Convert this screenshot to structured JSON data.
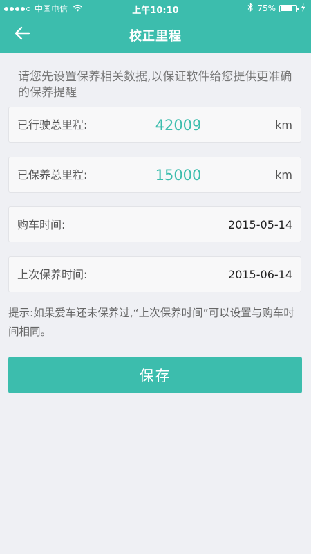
{
  "status_bar": {
    "carrier": "中国电信",
    "time": "上午10:10",
    "battery_text": "75%",
    "battery_level": 0.75
  },
  "nav": {
    "title": "校正里程",
    "back_icon": "arrow-left-icon"
  },
  "intro": "请您先设置保养相关数据,以保证软件给您提供更准确的保养提醒",
  "fields": {
    "total_mileage": {
      "label": "已行驶总里程:",
      "value": "42009",
      "unit": "km"
    },
    "maintained_mileage": {
      "label": "已保养总里程:",
      "value": "15000",
      "unit": "km"
    },
    "purchase_date": {
      "label": "购车时间:",
      "value": "2015-05-14"
    },
    "last_maintenance_date": {
      "label": "上次保养时间:",
      "value": "2015-06-14"
    }
  },
  "hint": "提示:如果爱车还未保养过,“上次保养时间”可以设置与购车时间相同。",
  "save_label": "保存",
  "colors": {
    "accent": "#3cbdad",
    "background": "#eff0f4"
  }
}
